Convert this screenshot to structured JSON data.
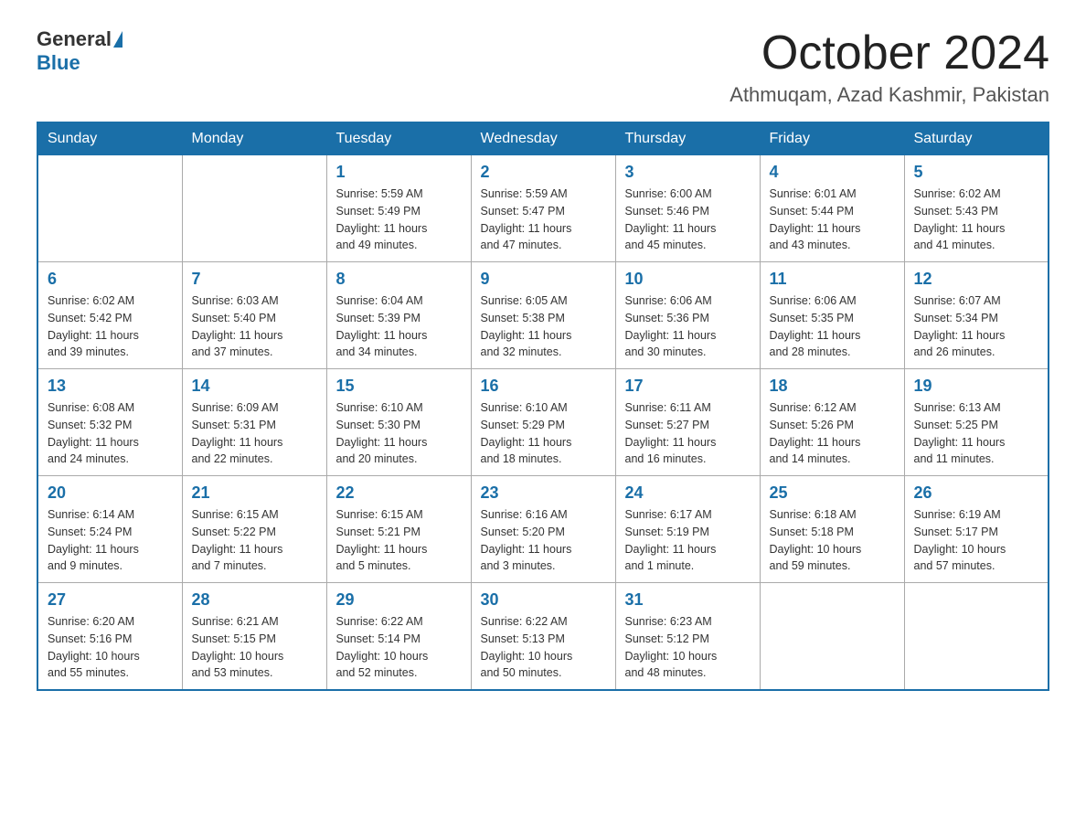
{
  "header": {
    "logo": {
      "general": "General",
      "blue": "Blue"
    },
    "title": "October 2024",
    "location": "Athmuqam, Azad Kashmir, Pakistan"
  },
  "days_of_week": [
    "Sunday",
    "Monday",
    "Tuesday",
    "Wednesday",
    "Thursday",
    "Friday",
    "Saturday"
  ],
  "weeks": [
    [
      {
        "day": "",
        "info": ""
      },
      {
        "day": "",
        "info": ""
      },
      {
        "day": "1",
        "info": "Sunrise: 5:59 AM\nSunset: 5:49 PM\nDaylight: 11 hours\nand 49 minutes."
      },
      {
        "day": "2",
        "info": "Sunrise: 5:59 AM\nSunset: 5:47 PM\nDaylight: 11 hours\nand 47 minutes."
      },
      {
        "day": "3",
        "info": "Sunrise: 6:00 AM\nSunset: 5:46 PM\nDaylight: 11 hours\nand 45 minutes."
      },
      {
        "day": "4",
        "info": "Sunrise: 6:01 AM\nSunset: 5:44 PM\nDaylight: 11 hours\nand 43 minutes."
      },
      {
        "day": "5",
        "info": "Sunrise: 6:02 AM\nSunset: 5:43 PM\nDaylight: 11 hours\nand 41 minutes."
      }
    ],
    [
      {
        "day": "6",
        "info": "Sunrise: 6:02 AM\nSunset: 5:42 PM\nDaylight: 11 hours\nand 39 minutes."
      },
      {
        "day": "7",
        "info": "Sunrise: 6:03 AM\nSunset: 5:40 PM\nDaylight: 11 hours\nand 37 minutes."
      },
      {
        "day": "8",
        "info": "Sunrise: 6:04 AM\nSunset: 5:39 PM\nDaylight: 11 hours\nand 34 minutes."
      },
      {
        "day": "9",
        "info": "Sunrise: 6:05 AM\nSunset: 5:38 PM\nDaylight: 11 hours\nand 32 minutes."
      },
      {
        "day": "10",
        "info": "Sunrise: 6:06 AM\nSunset: 5:36 PM\nDaylight: 11 hours\nand 30 minutes."
      },
      {
        "day": "11",
        "info": "Sunrise: 6:06 AM\nSunset: 5:35 PM\nDaylight: 11 hours\nand 28 minutes."
      },
      {
        "day": "12",
        "info": "Sunrise: 6:07 AM\nSunset: 5:34 PM\nDaylight: 11 hours\nand 26 minutes."
      }
    ],
    [
      {
        "day": "13",
        "info": "Sunrise: 6:08 AM\nSunset: 5:32 PM\nDaylight: 11 hours\nand 24 minutes."
      },
      {
        "day": "14",
        "info": "Sunrise: 6:09 AM\nSunset: 5:31 PM\nDaylight: 11 hours\nand 22 minutes."
      },
      {
        "day": "15",
        "info": "Sunrise: 6:10 AM\nSunset: 5:30 PM\nDaylight: 11 hours\nand 20 minutes."
      },
      {
        "day": "16",
        "info": "Sunrise: 6:10 AM\nSunset: 5:29 PM\nDaylight: 11 hours\nand 18 minutes."
      },
      {
        "day": "17",
        "info": "Sunrise: 6:11 AM\nSunset: 5:27 PM\nDaylight: 11 hours\nand 16 minutes."
      },
      {
        "day": "18",
        "info": "Sunrise: 6:12 AM\nSunset: 5:26 PM\nDaylight: 11 hours\nand 14 minutes."
      },
      {
        "day": "19",
        "info": "Sunrise: 6:13 AM\nSunset: 5:25 PM\nDaylight: 11 hours\nand 11 minutes."
      }
    ],
    [
      {
        "day": "20",
        "info": "Sunrise: 6:14 AM\nSunset: 5:24 PM\nDaylight: 11 hours\nand 9 minutes."
      },
      {
        "day": "21",
        "info": "Sunrise: 6:15 AM\nSunset: 5:22 PM\nDaylight: 11 hours\nand 7 minutes."
      },
      {
        "day": "22",
        "info": "Sunrise: 6:15 AM\nSunset: 5:21 PM\nDaylight: 11 hours\nand 5 minutes."
      },
      {
        "day": "23",
        "info": "Sunrise: 6:16 AM\nSunset: 5:20 PM\nDaylight: 11 hours\nand 3 minutes."
      },
      {
        "day": "24",
        "info": "Sunrise: 6:17 AM\nSunset: 5:19 PM\nDaylight: 11 hours\nand 1 minute."
      },
      {
        "day": "25",
        "info": "Sunrise: 6:18 AM\nSunset: 5:18 PM\nDaylight: 10 hours\nand 59 minutes."
      },
      {
        "day": "26",
        "info": "Sunrise: 6:19 AM\nSunset: 5:17 PM\nDaylight: 10 hours\nand 57 minutes."
      }
    ],
    [
      {
        "day": "27",
        "info": "Sunrise: 6:20 AM\nSunset: 5:16 PM\nDaylight: 10 hours\nand 55 minutes."
      },
      {
        "day": "28",
        "info": "Sunrise: 6:21 AM\nSunset: 5:15 PM\nDaylight: 10 hours\nand 53 minutes."
      },
      {
        "day": "29",
        "info": "Sunrise: 6:22 AM\nSunset: 5:14 PM\nDaylight: 10 hours\nand 52 minutes."
      },
      {
        "day": "30",
        "info": "Sunrise: 6:22 AM\nSunset: 5:13 PM\nDaylight: 10 hours\nand 50 minutes."
      },
      {
        "day": "31",
        "info": "Sunrise: 6:23 AM\nSunset: 5:12 PM\nDaylight: 10 hours\nand 48 minutes."
      },
      {
        "day": "",
        "info": ""
      },
      {
        "day": "",
        "info": ""
      }
    ]
  ]
}
